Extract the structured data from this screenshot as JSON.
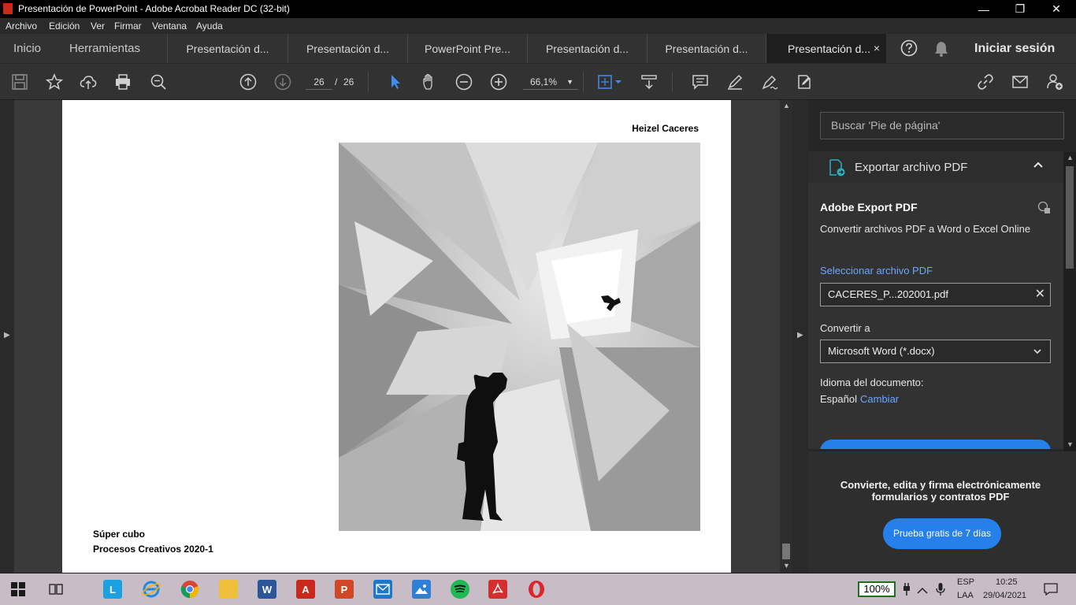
{
  "window": {
    "title": "Presentación de PowerPoint - Adobe Acrobat Reader DC (32-bit)",
    "minimize": "—",
    "restore": "❐",
    "close": "✕"
  },
  "menu": [
    "Archivo",
    "Edición",
    "Ver",
    "Firmar",
    "Ventana",
    "Ayuda"
  ],
  "nav": {
    "home": "Inicio",
    "tools": "Herramientas",
    "signin": "Iniciar sesión"
  },
  "tabs": [
    {
      "label": "Presentación d..."
    },
    {
      "label": "Presentación d..."
    },
    {
      "label": "PowerPoint Pre..."
    },
    {
      "label": "Presentación d..."
    },
    {
      "label": "Presentación d..."
    },
    {
      "label": "Presentación d...",
      "active": true
    }
  ],
  "tab_close": "×",
  "toolbar": {
    "current_page": "26",
    "separator": "/",
    "total_pages": "26",
    "zoom": "66,1%"
  },
  "document": {
    "author": "Heizel Caceres",
    "caption_title": "Súper cubo",
    "caption_course": "Procesos Creativos 2020-1"
  },
  "right_pane": {
    "search_placeholder": "Buscar 'Pie de página'",
    "export_header": "Exportar archivo PDF",
    "export_title": "Adobe Export PDF",
    "export_desc": "Convertir archivos PDF a Word o Excel Online",
    "select_file_link": "Seleccionar archivo PDF",
    "selected_file": "CACERES_P...202001.pdf",
    "convert_to_label": "Convertir a",
    "convert_to_value": "Microsoft Word (*.docx)",
    "language_label": "Idioma del documento:",
    "language_value": "Español",
    "change_link": "Cambiar",
    "promo_text": "Convierte, edita y firma electrónicamente formularios y contratos PDF",
    "promo_button": "Prueba gratis de 7 días"
  },
  "taskbar": {
    "battery": "100%",
    "lang_top": "ESP",
    "lang_bottom": "LAA",
    "time": "10:25",
    "date": "29/04/2021"
  },
  "colors": {
    "accent_blue": "#2680eb",
    "link_blue": "#6aa7ff"
  }
}
